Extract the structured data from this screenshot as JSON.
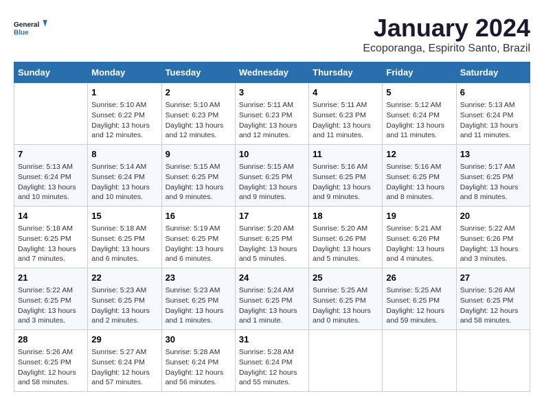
{
  "logo": {
    "line1": "General",
    "line2": "Blue"
  },
  "title": "January 2024",
  "subtitle": "Ecoporanga, Espirito Santo, Brazil",
  "weekdays": [
    "Sunday",
    "Monday",
    "Tuesday",
    "Wednesday",
    "Thursday",
    "Friday",
    "Saturday"
  ],
  "weeks": [
    [
      {
        "day": "",
        "info": ""
      },
      {
        "day": "1",
        "info": "Sunrise: 5:10 AM\nSunset: 6:22 PM\nDaylight: 13 hours\nand 12 minutes."
      },
      {
        "day": "2",
        "info": "Sunrise: 5:10 AM\nSunset: 6:23 PM\nDaylight: 13 hours\nand 12 minutes."
      },
      {
        "day": "3",
        "info": "Sunrise: 5:11 AM\nSunset: 6:23 PM\nDaylight: 13 hours\nand 12 minutes."
      },
      {
        "day": "4",
        "info": "Sunrise: 5:11 AM\nSunset: 6:23 PM\nDaylight: 13 hours\nand 11 minutes."
      },
      {
        "day": "5",
        "info": "Sunrise: 5:12 AM\nSunset: 6:24 PM\nDaylight: 13 hours\nand 11 minutes."
      },
      {
        "day": "6",
        "info": "Sunrise: 5:13 AM\nSunset: 6:24 PM\nDaylight: 13 hours\nand 11 minutes."
      }
    ],
    [
      {
        "day": "7",
        "info": "Sunrise: 5:13 AM\nSunset: 6:24 PM\nDaylight: 13 hours\nand 10 minutes."
      },
      {
        "day": "8",
        "info": "Sunrise: 5:14 AM\nSunset: 6:24 PM\nDaylight: 13 hours\nand 10 minutes."
      },
      {
        "day": "9",
        "info": "Sunrise: 5:15 AM\nSunset: 6:25 PM\nDaylight: 13 hours\nand 9 minutes."
      },
      {
        "day": "10",
        "info": "Sunrise: 5:15 AM\nSunset: 6:25 PM\nDaylight: 13 hours\nand 9 minutes."
      },
      {
        "day": "11",
        "info": "Sunrise: 5:16 AM\nSunset: 6:25 PM\nDaylight: 13 hours\nand 9 minutes."
      },
      {
        "day": "12",
        "info": "Sunrise: 5:16 AM\nSunset: 6:25 PM\nDaylight: 13 hours\nand 8 minutes."
      },
      {
        "day": "13",
        "info": "Sunrise: 5:17 AM\nSunset: 6:25 PM\nDaylight: 13 hours\nand 8 minutes."
      }
    ],
    [
      {
        "day": "14",
        "info": "Sunrise: 5:18 AM\nSunset: 6:25 PM\nDaylight: 13 hours\nand 7 minutes."
      },
      {
        "day": "15",
        "info": "Sunrise: 5:18 AM\nSunset: 6:25 PM\nDaylight: 13 hours\nand 6 minutes."
      },
      {
        "day": "16",
        "info": "Sunrise: 5:19 AM\nSunset: 6:25 PM\nDaylight: 13 hours\nand 6 minutes."
      },
      {
        "day": "17",
        "info": "Sunrise: 5:20 AM\nSunset: 6:25 PM\nDaylight: 13 hours\nand 5 minutes."
      },
      {
        "day": "18",
        "info": "Sunrise: 5:20 AM\nSunset: 6:26 PM\nDaylight: 13 hours\nand 5 minutes."
      },
      {
        "day": "19",
        "info": "Sunrise: 5:21 AM\nSunset: 6:26 PM\nDaylight: 13 hours\nand 4 minutes."
      },
      {
        "day": "20",
        "info": "Sunrise: 5:22 AM\nSunset: 6:26 PM\nDaylight: 13 hours\nand 3 minutes."
      }
    ],
    [
      {
        "day": "21",
        "info": "Sunrise: 5:22 AM\nSunset: 6:25 PM\nDaylight: 13 hours\nand 3 minutes."
      },
      {
        "day": "22",
        "info": "Sunrise: 5:23 AM\nSunset: 6:25 PM\nDaylight: 13 hours\nand 2 minutes."
      },
      {
        "day": "23",
        "info": "Sunrise: 5:23 AM\nSunset: 6:25 PM\nDaylight: 13 hours\nand 1 minutes."
      },
      {
        "day": "24",
        "info": "Sunrise: 5:24 AM\nSunset: 6:25 PM\nDaylight: 13 hours\nand 1 minute."
      },
      {
        "day": "25",
        "info": "Sunrise: 5:25 AM\nSunset: 6:25 PM\nDaylight: 13 hours\nand 0 minutes."
      },
      {
        "day": "26",
        "info": "Sunrise: 5:25 AM\nSunset: 6:25 PM\nDaylight: 12 hours\nand 59 minutes."
      },
      {
        "day": "27",
        "info": "Sunrise: 5:26 AM\nSunset: 6:25 PM\nDaylight: 12 hours\nand 58 minutes."
      }
    ],
    [
      {
        "day": "28",
        "info": "Sunrise: 5:26 AM\nSunset: 6:25 PM\nDaylight: 12 hours\nand 58 minutes."
      },
      {
        "day": "29",
        "info": "Sunrise: 5:27 AM\nSunset: 6:24 PM\nDaylight: 12 hours\nand 57 minutes."
      },
      {
        "day": "30",
        "info": "Sunrise: 5:28 AM\nSunset: 6:24 PM\nDaylight: 12 hours\nand 56 minutes."
      },
      {
        "day": "31",
        "info": "Sunrise: 5:28 AM\nSunset: 6:24 PM\nDaylight: 12 hours\nand 55 minutes."
      },
      {
        "day": "",
        "info": ""
      },
      {
        "day": "",
        "info": ""
      },
      {
        "day": "",
        "info": ""
      }
    ]
  ]
}
